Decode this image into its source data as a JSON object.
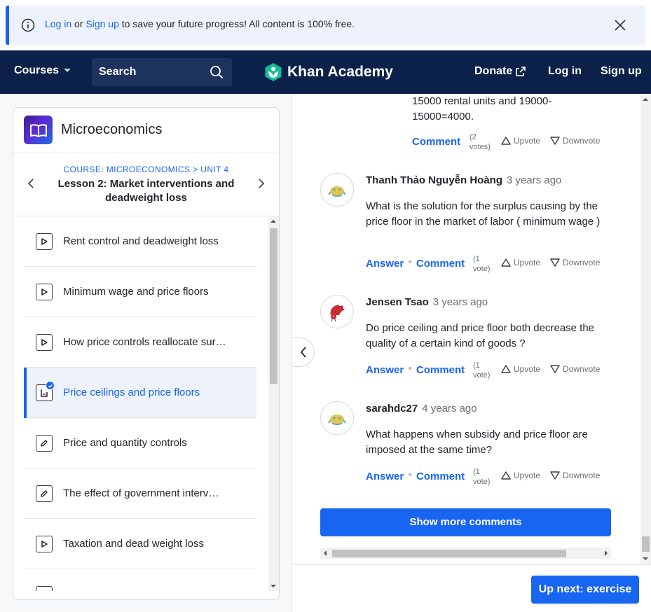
{
  "banner": {
    "login_link": "Log in",
    "or_text": " or ",
    "signup_link": "Sign up",
    "message": " to save your future progress! All content is 100% free."
  },
  "nav": {
    "courses_label": "Courses",
    "search_placeholder": "Search",
    "logo_text": "Khan Academy",
    "donate_label": "Donate",
    "login_label": "Log in",
    "signup_label": "Sign up"
  },
  "course": {
    "title": "Microeconomics",
    "breadcrumb_course": "COURSE: MICROECONOMICS",
    "breadcrumb_sep": " > ",
    "breadcrumb_unit": "UNIT 4",
    "lesson_title": "Lesson 2: Market interventions and deadweight loss"
  },
  "items": [
    {
      "label": "Rent control and deadweight loss",
      "icon": "play-icon"
    },
    {
      "label": "Minimum wage and price floors",
      "icon": "play-icon"
    },
    {
      "label": "How price controls reallocate sur…",
      "icon": "play-icon"
    },
    {
      "label": "Price ceilings and price floors",
      "icon": "article-icon"
    },
    {
      "label": "Price and quantity controls",
      "icon": "pencil-icon"
    },
    {
      "label": "The effect of government interv…",
      "icon": "pencil-icon"
    },
    {
      "label": "Taxation and dead weight loss",
      "icon": "play-icon"
    }
  ],
  "partial_comment": {
    "line1": "15000 rental units and 19000-",
    "line2": "15000=4000.",
    "comment_label": "Comment",
    "votes_line1": "(2",
    "votes_line2": "votes)",
    "upvote": "Upvote",
    "downvote": "Downvote"
  },
  "comments": [
    {
      "author": "Thanh Thảo Nguyễn Hoàng",
      "ago": "3 years ago",
      "body": "What is the solution for the surplus causing by the price floor in the market of labor ( minimum wage )",
      "answer_label": "Answer",
      "comment_label": "Comment",
      "votes_line1": "(1",
      "votes_line2": "vote)",
      "upvote": "Upvote",
      "downvote": "Downvote"
    },
    {
      "author": "Jensen Tsao",
      "ago": "3 years ago",
      "body": "Do price ceiling and price floor both decrease the quality of a certain kind of goods ?",
      "answer_label": "Answer",
      "comment_label": "Comment",
      "votes_line1": "(1",
      "votes_line2": "vote)",
      "upvote": "Upvote",
      "downvote": "Downvote"
    },
    {
      "author": "sarahdc27",
      "ago": "4 years ago",
      "body": "What happens when subsidy and price floor are imposed at the same time?",
      "answer_label": "Answer",
      "comment_label": "Comment",
      "votes_line1": "(1",
      "votes_line2": "vote)",
      "upvote": "Upvote",
      "downvote": "Downvote"
    }
  ],
  "show_more_label": "Show more comments",
  "up_next_label": "Up next: exercise",
  "colors": {
    "accent": "#1865f2",
    "nav_bg": "#0b2149",
    "banner_bg": "#edf2fd",
    "logo_green": "#14bf96"
  }
}
